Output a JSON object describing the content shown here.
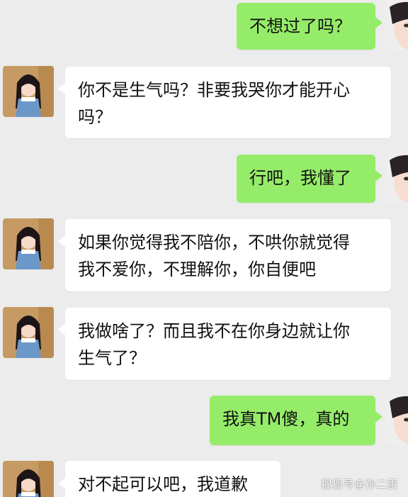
{
  "messages": [
    {
      "side": "right",
      "text": "不想过了吗？"
    },
    {
      "side": "left",
      "text": "你不是生气吗？非要我哭你才能开心\n吗？"
    },
    {
      "side": "right",
      "text": "行吧，我懂了"
    },
    {
      "side": "left",
      "text": "如果你觉得我不陪你，不哄你就觉得\n我不爱你，不理解你，你自便吧"
    },
    {
      "side": "left",
      "text": "我做啥了？而且我不在你身边就让你\n生气了？"
    },
    {
      "side": "right",
      "text": "我真TM傻，真的"
    },
    {
      "side": "left",
      "text": "对不起可以吧，我道歉"
    }
  ],
  "watermark": "搜狐号@孙二蛋",
  "colors": {
    "background": "#ececec",
    "left_bubble": "#ffffff",
    "right_bubble": "#95ec69"
  },
  "icons": {
    "left_avatar": "girl-avatar",
    "right_avatar": "boy-avatar"
  }
}
